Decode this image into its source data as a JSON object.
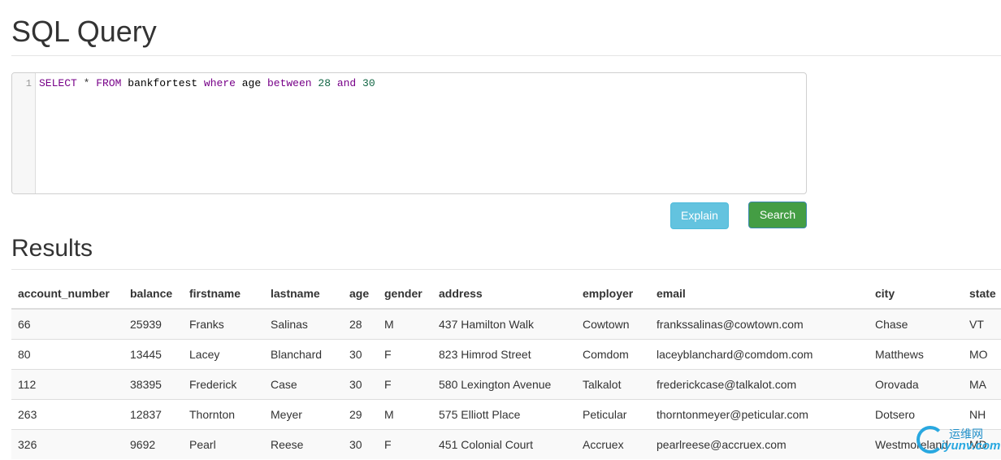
{
  "page": {
    "title": "SQL Query"
  },
  "editor": {
    "line_number": "1",
    "tokens": {
      "select": "SELECT",
      "star": "*",
      "from": "FROM",
      "table": "bankfortest",
      "where": "where",
      "column": "age",
      "between": "between",
      "low": "28",
      "and": "and",
      "high": "30"
    }
  },
  "buttons": {
    "explain": "Explain",
    "search": "Search"
  },
  "results": {
    "title": "Results",
    "columns": [
      "account_number",
      "balance",
      "firstname",
      "lastname",
      "age",
      "gender",
      "address",
      "employer",
      "email",
      "city",
      "state"
    ],
    "rows": [
      [
        "66",
        "25939",
        "Franks",
        "Salinas",
        "28",
        "M",
        "437 Hamilton Walk",
        "Cowtown",
        "frankssalinas@cowtown.com",
        "Chase",
        "VT"
      ],
      [
        "80",
        "13445",
        "Lacey",
        "Blanchard",
        "30",
        "F",
        "823 Himrod Street",
        "Comdom",
        "laceyblanchard@comdom.com",
        "Matthews",
        "MO"
      ],
      [
        "112",
        "38395",
        "Frederick",
        "Case",
        "30",
        "F",
        "580 Lexington Avenue",
        "Talkalot",
        "frederickcase@talkalot.com",
        "Orovada",
        "MA"
      ],
      [
        "263",
        "12837",
        "Thornton",
        "Meyer",
        "29",
        "M",
        "575 Elliott Place",
        "Peticular",
        "thorntonmeyer@peticular.com",
        "Dotsero",
        "NH"
      ],
      [
        "326",
        "9692",
        "Pearl",
        "Reese",
        "30",
        "F",
        "451 Colonial Court",
        "Accruex",
        "pearlreese@accruex.com",
        "Westmoreland",
        "MD"
      ]
    ]
  },
  "watermark": {
    "cn": "运维网",
    "en": "iyunv.com"
  },
  "colors": {
    "explain_button": "#5bc0de",
    "search_button": "#449d44",
    "sql_keyword": "#770088",
    "sql_number": "#116644"
  }
}
